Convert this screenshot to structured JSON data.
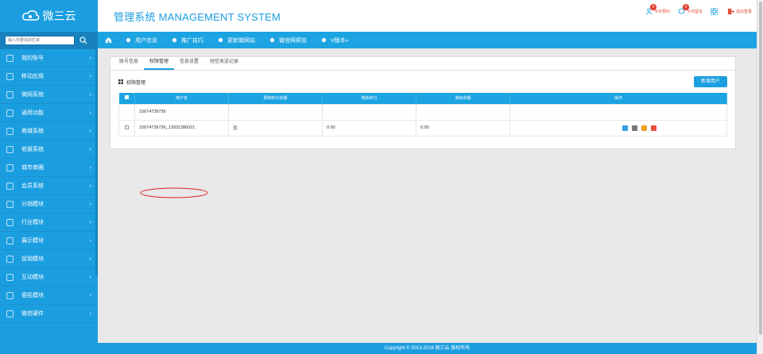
{
  "logo": {
    "text": "微三云"
  },
  "search": {
    "placeholder": "输入你要找的栏目"
  },
  "sidebar": {
    "items": [
      {
        "label": "我的账号",
        "icon": "user-icon"
      },
      {
        "label": "移动应用",
        "icon": "apps-icon"
      },
      {
        "label": "微网系统",
        "icon": "globe-icon"
      },
      {
        "label": "通用功能",
        "icon": "tool-icon"
      },
      {
        "label": "商城系统",
        "icon": "cart-icon"
      },
      {
        "label": "收银系统",
        "icon": "cashier-icon"
      },
      {
        "label": "城市商圈",
        "icon": "share-icon"
      },
      {
        "label": "会员系统",
        "icon": "member-icon"
      },
      {
        "label": "分销模块",
        "icon": "share-icon"
      },
      {
        "label": "行业模块",
        "icon": "grid-icon"
      },
      {
        "label": "展示模块",
        "icon": "display-icon"
      },
      {
        "label": "促销模块",
        "icon": "tag-icon"
      },
      {
        "label": "互动模块",
        "icon": "interact-icon"
      },
      {
        "label": "便民模块",
        "icon": "service-icon"
      },
      {
        "label": "微信硬件",
        "icon": "hardware-icon"
      }
    ],
    "chevron": "›"
  },
  "header": {
    "title": "管理系统 MANAGEMENT SYSTEM",
    "today_appointments": {
      "label": "今日预约",
      "count": "0"
    },
    "today_messages": {
      "label": "今日留言",
      "count": "0"
    },
    "logout": "退出登录"
  },
  "topnav": {
    "items": [
      {
        "label": "用户信息"
      },
      {
        "label": "推广技巧"
      },
      {
        "label": "更新微网站"
      },
      {
        "label": "微官网预览"
      },
      {
        "label": "V版本»"
      }
    ]
  },
  "tabs": [
    "账号信息",
    "权限管理",
    "信息设置",
    "短信发送记录"
  ],
  "active_tab": 1,
  "panel": {
    "title": "权限管理",
    "add_button": "新增用户"
  },
  "table": {
    "headers": [
      "用户名",
      "限制积分余额",
      "剩余积分",
      "剩余余额",
      "操作"
    ],
    "rows": [
      {
        "username": "15674739736",
        "limit": "",
        "points": "",
        "balance": "",
        "has_checkbox": false,
        "has_ops": false
      },
      {
        "username": "15674739736_13931386021",
        "limit": "否",
        "points": "0.00",
        "balance": "0.00",
        "has_checkbox": true,
        "has_ops": true
      }
    ]
  },
  "footer": {
    "text": "Copyright © 2013-2016   微三云 版权所有"
  },
  "colors": {
    "primary": "#1b9ee0",
    "header_title": "#1b9ee0",
    "alert": "#e04e3a"
  }
}
